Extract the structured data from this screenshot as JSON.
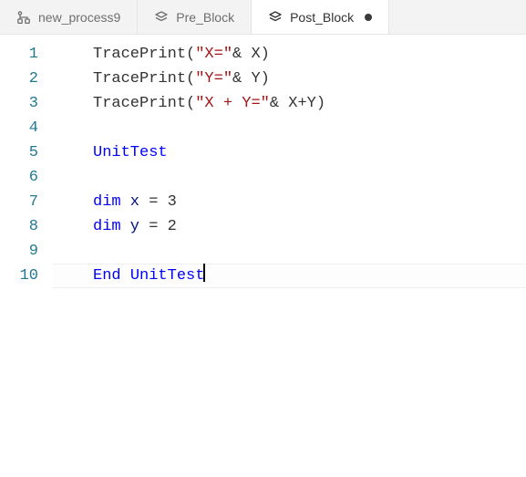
{
  "tabs": [
    {
      "label": "new_process9",
      "icon": "workflow-icon",
      "active": false,
      "dirty": false
    },
    {
      "label": "Pre_Block",
      "icon": "layers-icon",
      "active": false,
      "dirty": false
    },
    {
      "label": "Post_Block",
      "icon": "layers-icon",
      "active": true,
      "dirty": true
    }
  ],
  "code": {
    "lines": [
      {
        "n": "1",
        "tokens": [
          {
            "t": "TracePrint",
            "c": "fn"
          },
          {
            "t": "(",
            "c": "op"
          },
          {
            "t": "\"X=\"",
            "c": "str"
          },
          {
            "t": "& X)",
            "c": "op"
          }
        ]
      },
      {
        "n": "2",
        "tokens": [
          {
            "t": "TracePrint",
            "c": "fn"
          },
          {
            "t": "(",
            "c": "op"
          },
          {
            "t": "\"Y=\"",
            "c": "str"
          },
          {
            "t": "& Y)",
            "c": "op"
          }
        ]
      },
      {
        "n": "3",
        "tokens": [
          {
            "t": "TracePrint",
            "c": "fn"
          },
          {
            "t": "(",
            "c": "op"
          },
          {
            "t": "\"X + Y=\"",
            "c": "str"
          },
          {
            "t": "& X+Y)",
            "c": "op"
          }
        ]
      },
      {
        "n": "4",
        "tokens": []
      },
      {
        "n": "5",
        "tokens": [
          {
            "t": "UnitTest",
            "c": "kw"
          }
        ]
      },
      {
        "n": "6",
        "tokens": []
      },
      {
        "n": "7",
        "tokens": [
          {
            "t": "dim",
            "c": "kw"
          },
          {
            "t": " x ",
            "c": "var"
          },
          {
            "t": "=",
            "c": "op"
          },
          {
            "t": " 3",
            "c": "op"
          }
        ]
      },
      {
        "n": "8",
        "tokens": [
          {
            "t": "dim",
            "c": "kw"
          },
          {
            "t": " y ",
            "c": "var"
          },
          {
            "t": "=",
            "c": "op"
          },
          {
            "t": " 2",
            "c": "op"
          }
        ]
      },
      {
        "n": "9",
        "tokens": []
      },
      {
        "n": "10",
        "tokens": [
          {
            "t": "End",
            "c": "kw"
          },
          {
            "t": " ",
            "c": "op"
          },
          {
            "t": "UnitTest",
            "c": "kw"
          }
        ],
        "caret": true,
        "current": true
      }
    ]
  }
}
